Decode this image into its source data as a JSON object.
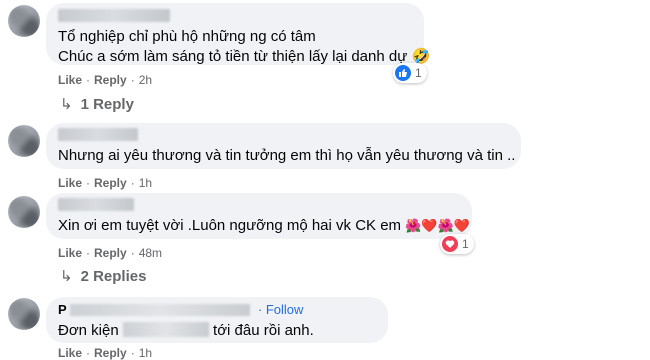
{
  "comments": [
    {
      "line1": "Tổ nghiệp chỉ phù hộ những ng có tâm",
      "line2": "Chúc a sớm làm sáng tỏ tiền từ thiện lấy lại danh dự",
      "like": "Like",
      "reply": "Reply",
      "time": "2h",
      "reaction_count": "1",
      "reaction_icon": "like-icon",
      "replies_label": "1 Reply"
    },
    {
      "text": "Nhưng ai yêu thương và tin tưởng em thì họ vẫn yêu thương và tin ..",
      "like": "Like",
      "reply": "Reply",
      "time": "1h"
    },
    {
      "text": "Xin ơi em tuyệt vời .Luôn ngưỡng mộ hai vk CK em",
      "emojis": "🌺❤️🌺❤️",
      "like": "Like",
      "reply": "Reply",
      "time": "48m",
      "reaction_count": "1",
      "reaction_icon": "love-icon",
      "replies_label": "2 Replies"
    },
    {
      "name_initial": "P",
      "follow": "· Follow",
      "text_before": "Đơn kiện",
      "text_after": "tới đâu rồi anh.",
      "like": "Like",
      "reply": "Reply",
      "time": "1h"
    }
  ],
  "colors": {
    "like_blue": "#1877f2",
    "love_red": "#f33e58",
    "follow_blue": "#216fdb"
  }
}
